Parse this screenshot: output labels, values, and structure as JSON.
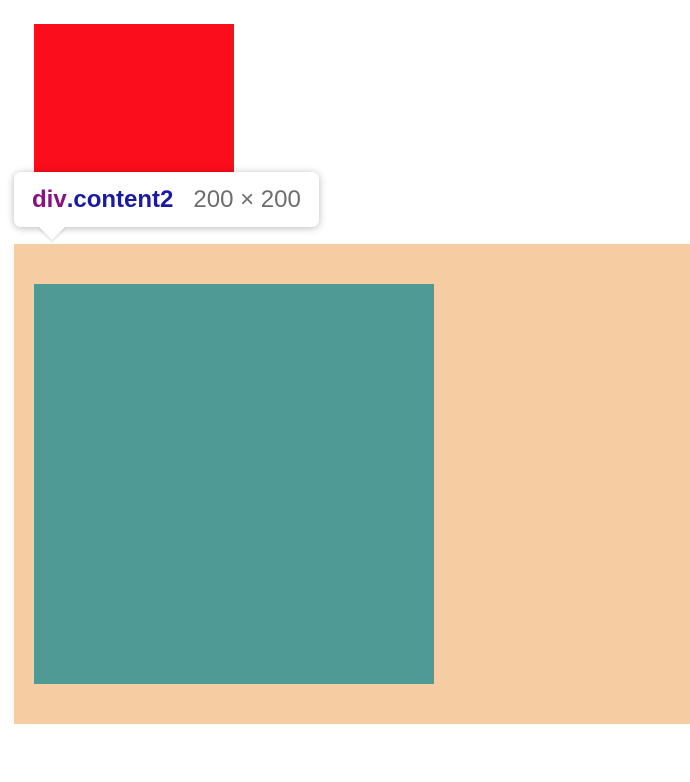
{
  "colors": {
    "red_box": "#fc0d1b",
    "highlight_margin": "#f6cda2",
    "teal_content": "#4f9a95",
    "tooltip_tag": "#881280",
    "tooltip_class": "#1a1aa6",
    "tooltip_dims": "#6e6e6e"
  },
  "tooltip": {
    "tag": "div",
    "class_name": ".content2",
    "dimensions": "200 × 200"
  }
}
